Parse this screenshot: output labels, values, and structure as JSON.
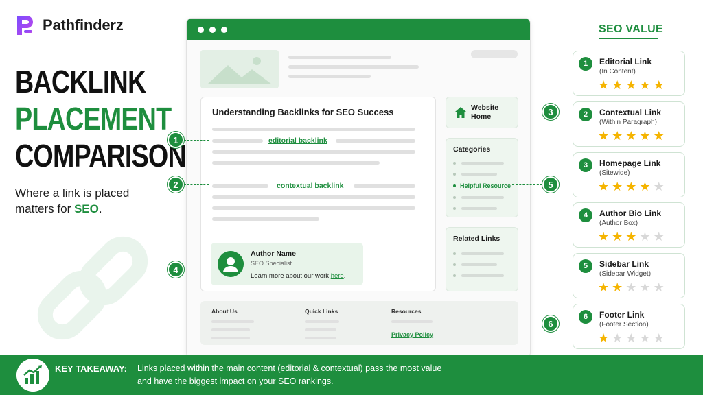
{
  "brand": {
    "name": "Pathfinderz"
  },
  "headline": {
    "line1": "BACKLINK",
    "line2": "PLACEMENT",
    "line3": "COMPARISON"
  },
  "subtitle": {
    "text": "Where a link is placed matters for ",
    "highlight": "SEO",
    "end": "."
  },
  "article": {
    "title": "Understanding Backlinks for SEO Success",
    "editorial_link": "editorial backlink",
    "contextual_link": "contextual backlink"
  },
  "author": {
    "name": "Author Name",
    "role": "SEO Specialist",
    "learn_text": "Learn more about our work ",
    "learn_link": "here",
    "learn_end": "."
  },
  "sidebar": {
    "home_label_1": "Website",
    "home_label_2": "Home",
    "categories_title": "Categories",
    "helpful_link": "Helpful Resource",
    "related_title": "Related Links"
  },
  "footer": {
    "col1": "About Us",
    "col2": "Quick Links",
    "col3": "Resources",
    "privacy_link": "Privacy Policy"
  },
  "markers": [
    "1",
    "2",
    "3",
    "4",
    "5",
    "6"
  ],
  "seo_value": {
    "heading": "SEO VALUE",
    "items": [
      {
        "num": "1",
        "title": "Editorial Link",
        "sub": "(In Content)",
        "stars": 5
      },
      {
        "num": "2",
        "title": "Contextual Link",
        "sub": "(Within Paragraph)",
        "stars": 5
      },
      {
        "num": "3",
        "title": "Homepage Link",
        "sub": "(Sitewide)",
        "stars": 4
      },
      {
        "num": "4",
        "title": "Author Bio Link",
        "sub": "(Author Box)",
        "stars": 3
      },
      {
        "num": "5",
        "title": "Sidebar Link",
        "sub": "(Sidebar Widget)",
        "stars": 2
      },
      {
        "num": "6",
        "title": "Footer Link",
        "sub": "(Footer Section)",
        "stars": 1
      }
    ],
    "max_stars": 5
  },
  "takeaway": {
    "label": "KEY TAKEAWAY:",
    "line1": "Links placed within the main content (editorial & contextual) pass the most value",
    "line2": "and have the biggest impact on your SEO rankings."
  },
  "colors": {
    "accent": "#1e8e3e",
    "star_on": "#f5b400",
    "star_off": "#d8d8d8"
  }
}
